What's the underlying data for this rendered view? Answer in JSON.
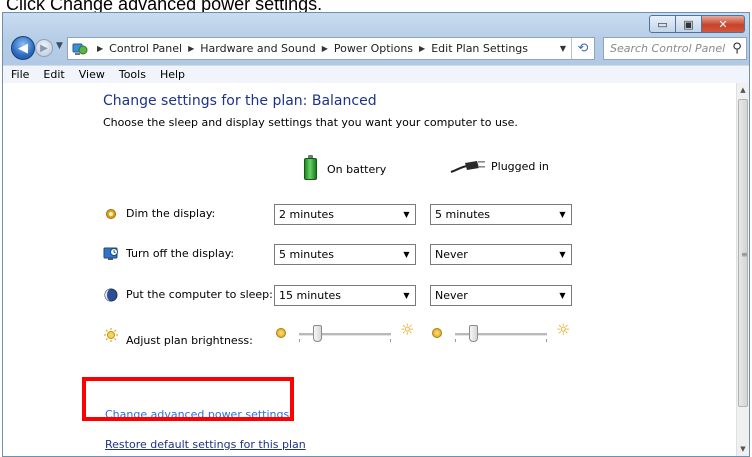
{
  "instruction": "Click Change advanced power settings.",
  "window": {
    "caption_buttons": {
      "minimize": "▭",
      "maximize": "▣",
      "close": "✕"
    }
  },
  "navigation": {
    "back_icon": "back-arrow-icon",
    "forward_icon": "forward-arrow-icon",
    "breadcrumbs": [
      "Control Panel",
      "Hardware and Sound",
      "Power Options",
      "Edit Plan Settings"
    ],
    "search_placeholder": "Search Control Panel"
  },
  "menu": [
    "File",
    "Edit",
    "View",
    "Tools",
    "Help"
  ],
  "page": {
    "heading": "Change settings for the plan: Balanced",
    "subheading": "Choose the sleep and display settings that you want your computer to use.",
    "columns": {
      "battery": "On battery",
      "plugged": "Plugged in"
    },
    "settings": [
      {
        "label": "Dim the display:",
        "icon": "dim-display-icon",
        "battery": "2 minutes",
        "plugged": "5 minutes"
      },
      {
        "label": "Turn off the display:",
        "icon": "display-off-icon",
        "battery": "5 minutes",
        "plugged": "Never"
      },
      {
        "label": "Put the computer to sleep:",
        "icon": "sleep-moon-icon",
        "battery": "15 minutes",
        "plugged": "Never"
      }
    ],
    "brightness": {
      "label": "Adjust plan brightness:",
      "battery_level": 0.2,
      "plugged_level": 0.2
    },
    "links": {
      "advanced": "Change advanced power settings",
      "restore": "Restore default settings for this plan"
    }
  },
  "colors": {
    "heading": "#1e3287",
    "link": "#2b6fd6",
    "highlight": "#ff0000"
  }
}
